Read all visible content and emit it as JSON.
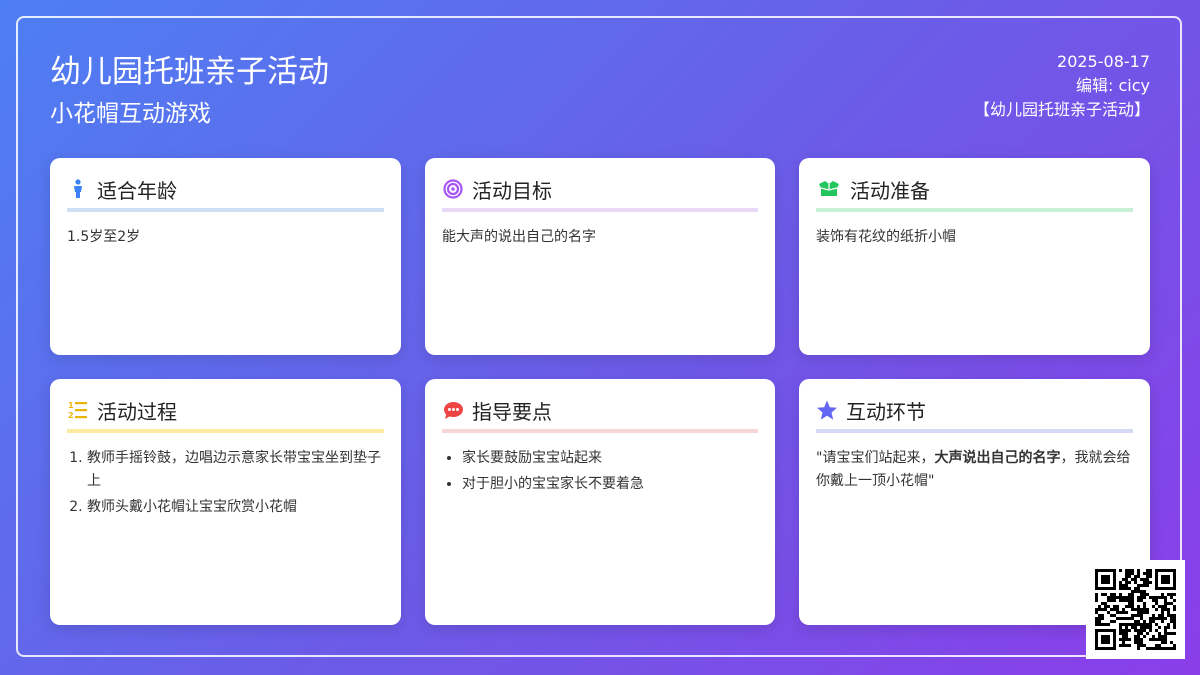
{
  "header": {
    "title": "幼儿园托班亲子活动",
    "subtitle": "小花帽互动游戏",
    "date": "2025-08-17",
    "editor": "编辑: cicy",
    "tag": "【幼儿园托班亲子活动】"
  },
  "cards": {
    "age": {
      "title": "适合年龄",
      "text": "1.5岁至2岁",
      "icon": "child-icon",
      "color": "#3b82f6"
    },
    "goal": {
      "title": "活动目标",
      "text": "能大声的说出自己的名字",
      "icon": "target-icon",
      "color": "#a855f7"
    },
    "prep": {
      "title": "活动准备",
      "text": "装饰有花纹的纸折小帽",
      "icon": "box-icon",
      "color": "#22c55e"
    },
    "process": {
      "title": "活动过程",
      "items": [
        "教师手摇铃鼓，边唱边示意家长带宝宝坐到垫子上",
        "教师头戴小花帽让宝宝欣赏小花帽"
      ],
      "icon": "list-numbered-icon",
      "color": "#eab308"
    },
    "guide": {
      "title": "指导要点",
      "items": [
        "家长要鼓励宝宝站起来",
        "对于胆小的宝宝家长不要着急"
      ],
      "icon": "chat-icon",
      "color": "#ef4444"
    },
    "interact": {
      "title": "互动环节",
      "text_before": "\"请宝宝们站起来，",
      "text_bold": "大声说出自己的名字",
      "text_after": "，我就会给你戴上一顶小花帽\"",
      "icon": "star-icon",
      "color": "#6366f1"
    }
  }
}
